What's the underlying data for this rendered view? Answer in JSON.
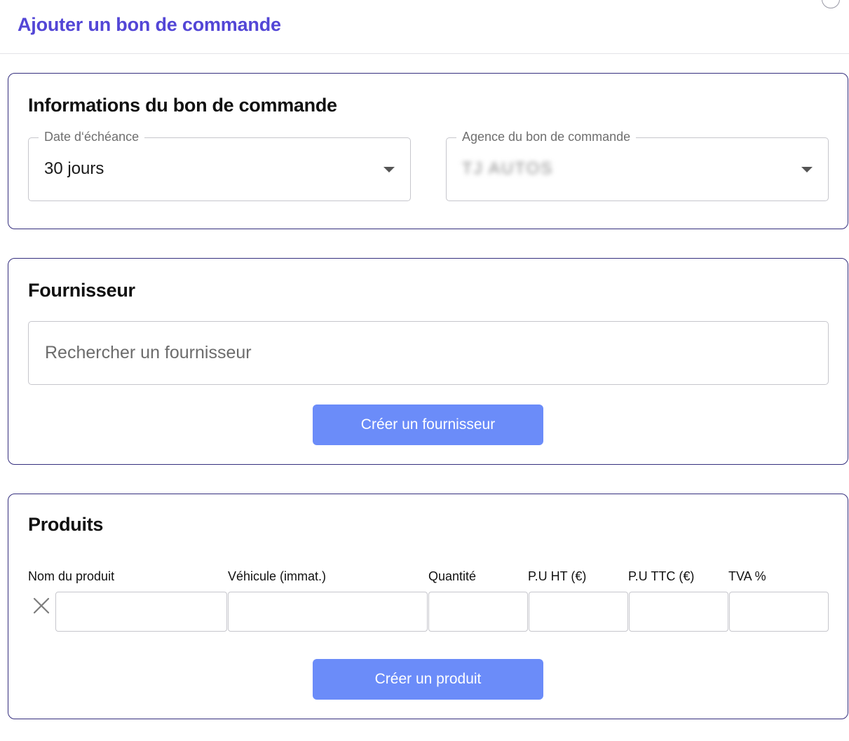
{
  "header": {
    "title": "Ajouter un bon de commande"
  },
  "info_section": {
    "title": "Informations du bon de commande",
    "due_date": {
      "label": "Date d‘échéance",
      "value": "30 jours"
    },
    "agency": {
      "label": "Agence du bon de commande",
      "value": "TJ AUTOS"
    }
  },
  "supplier_section": {
    "title": "Fournisseur",
    "search_placeholder": "Rechercher un fournisseur",
    "create_button": "Créer un fournisseur"
  },
  "products_section": {
    "title": "Produits",
    "columns": [
      "Nom du produit",
      "Véhicule (immat.)",
      "Quantité",
      "P.U HT (€)",
      "P.U TTC (€)",
      "TVA %"
    ],
    "rows": [
      {
        "name": "",
        "vehicle": "",
        "quantity": "",
        "unit_price_ht": "",
        "unit_price_ttc": "",
        "vat": ""
      }
    ],
    "create_button": "Créer un produit"
  },
  "colors": {
    "title_accent": "#5346d6",
    "card_border": "#352f7e",
    "button_bg": "#6b8cf9"
  },
  "icons": [
    "close-icon",
    "caret-down-icon",
    "remove-row-icon"
  ]
}
